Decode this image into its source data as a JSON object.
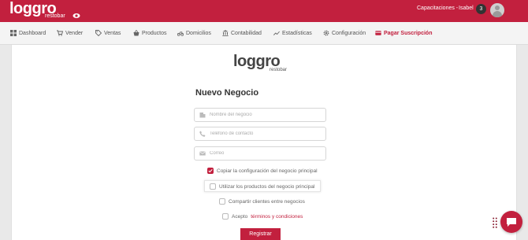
{
  "header": {
    "brand": "loggro",
    "brand_sub": "restobar",
    "menu_label": "Capacitaciones -",
    "user_name": "Isabel",
    "notification_count": "3"
  },
  "nav": {
    "items": [
      {
        "label": "Dashboard",
        "icon": "grid-icon"
      },
      {
        "label": "Vender",
        "icon": "cart-icon"
      },
      {
        "label": "Ventas",
        "icon": "tag-icon"
      },
      {
        "label": "Productos",
        "icon": "basket-icon"
      },
      {
        "label": "Domicilios",
        "icon": "bike-icon"
      },
      {
        "label": "Contabilidad",
        "icon": "bank-icon"
      },
      {
        "label": "Estadísticas",
        "icon": "trend-icon"
      },
      {
        "label": "Configuración",
        "icon": "gear-icon"
      },
      {
        "label": "Pagar Suscripción",
        "icon": "card-icon",
        "active": true
      }
    ]
  },
  "form": {
    "logo": "loggro",
    "logo_sub": "restobar",
    "title": "Nuevo Negocio",
    "fields": {
      "business_name": {
        "placeholder": "Nombre del negocio",
        "value": ""
      },
      "phone": {
        "placeholder": "Teléfono de contacto",
        "value": ""
      },
      "email": {
        "placeholder": "Correo",
        "value": ""
      }
    },
    "checks": {
      "copy_config": {
        "label": "Copiar la configuración del negocio principal",
        "checked": true
      },
      "use_products": {
        "label": "Utilizar los productos del negocio principal",
        "checked": false
      },
      "share_clients": {
        "label": "Compartir clientes entre negocios",
        "checked": false
      },
      "terms": {
        "prefix": "Acepto",
        "link": "términos y condiciones",
        "checked": false
      }
    },
    "submit_label": "Registrar"
  },
  "colors": {
    "accent": "#c2203e"
  }
}
